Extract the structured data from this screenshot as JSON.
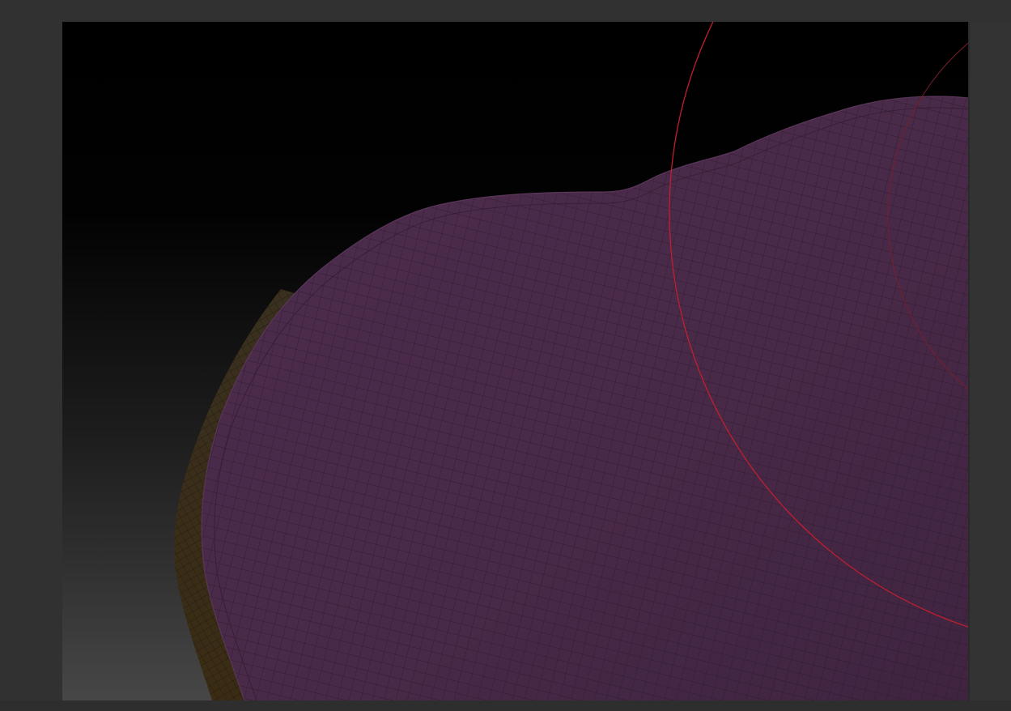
{
  "app": {
    "kind": "3d-sculpting-viewport"
  },
  "viewport": {
    "background_top": "#000000",
    "background_bottom": "#474747"
  },
  "mesh": {
    "surface_color": "#4a2a4a",
    "surface_color_highlight": "#522e52",
    "wire_color": "#2d1a2d",
    "backface_color": "#3d3019",
    "backface_wire": "#241c0e"
  },
  "brush_cursor": {
    "outer_color": "#c01f2e",
    "inner_color": "#7a1e2a"
  },
  "colors": {
    "chrome": "#313131",
    "chrome_dark": "#2a2a2a"
  }
}
